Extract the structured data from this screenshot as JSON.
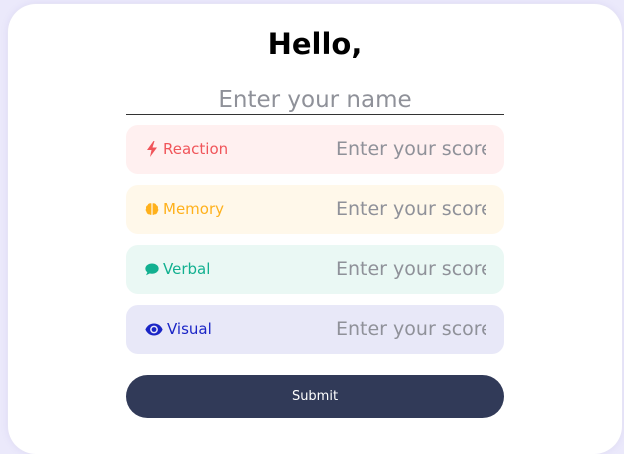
{
  "greeting": "Hello,",
  "name_input": {
    "placeholder": "Enter your name",
    "value": ""
  },
  "score_rows": [
    {
      "label": "Reaction",
      "icon": "lightning-bolt-icon",
      "placeholder": "Enter your score",
      "value": "",
      "color": "#f0555a",
      "background": "#fff0f0"
    },
    {
      "label": "Memory",
      "icon": "brain-icon",
      "placeholder": "Enter your score",
      "value": "",
      "color": "#ffb11c",
      "background": "#fff8ea"
    },
    {
      "label": "Verbal",
      "icon": "speech-bubble-icon",
      "placeholder": "Enter your score",
      "value": "",
      "color": "#12b090",
      "background": "#eaf8f4"
    },
    {
      "label": "Visual",
      "icon": "eye-icon",
      "placeholder": "Enter your score",
      "value": "",
      "color": "#1a25c6",
      "background": "#e8e8f8"
    }
  ],
  "submit": {
    "label": "Submit",
    "color": "#313a58"
  }
}
